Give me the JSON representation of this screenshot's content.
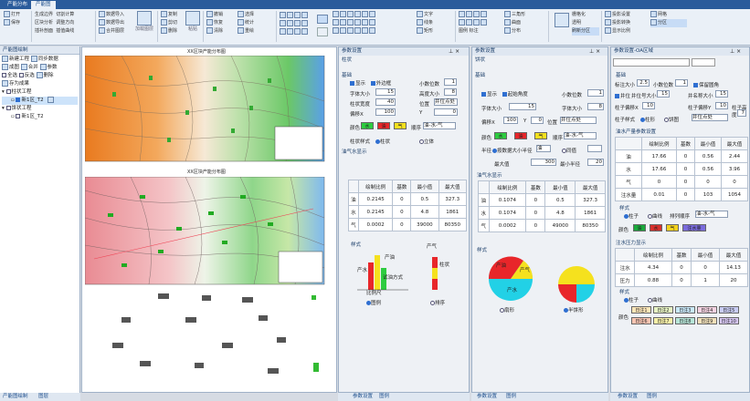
{
  "tabs": [
    "产能分布",
    "产能图"
  ],
  "ribbon": {
    "g1": [
      "打开",
      "保存"
    ],
    "g2": [
      "生成边界",
      "切割计算",
      "区块分析",
      "调整方向",
      "插补剖面",
      "插值曲线"
    ],
    "g3": [
      "数据导入",
      "数据导出",
      "合并图层"
    ],
    "g3b": "加载图层",
    "g4": [
      "复制",
      "剪切",
      "删除"
    ],
    "g4b": "粘贴",
    "g5": [
      "撤销",
      "恢复",
      "清除"
    ],
    "g6": [
      "选择",
      "统计",
      "重绘"
    ],
    "g7": [
      "全显",
      "缩放",
      "平移"
    ],
    "g8": [
      "文字",
      "线条",
      "矩形"
    ],
    "g9": [
      "图例",
      "标注"
    ],
    "g10": [
      "三角形",
      "曲面",
      "分布"
    ],
    "g11": [
      "栅格化",
      "透明",
      "刷新分区"
    ],
    "g12": [
      "投影设置",
      "投影转换",
      "显示比例"
    ],
    "g13": [
      "网格",
      "分区"
    ]
  },
  "left": {
    "title": "产能图绘制",
    "toolbar": [
      "新建工程",
      "同步数据",
      "成图",
      "合并",
      "参数"
    ],
    "toolbar2": [
      "全选",
      "反选",
      "删除"
    ],
    "nodes": [
      "存为成果",
      "柱状工程",
      "新1区_T2",
      "饼状工程",
      "新1区_T2"
    ],
    "bottom_tabs": [
      "产能图绘制",
      "图层"
    ]
  },
  "canvas": {
    "map1_title": "XX区块产能分布图",
    "map2_title": "XX区块产能分布图"
  },
  "p1": {
    "title": "参数设置",
    "sub": "柱状",
    "sec_basic": "基础",
    "chk_show": "显示",
    "chk_frame": "外边框",
    "decimal_label": "小数位数",
    "decimal_value": "1",
    "font_size_label": "字体大小",
    "font_size": "15",
    "height_label": "高度大小",
    "height_value": "8",
    "bar_width_label": "柱状宽度",
    "bar_width": "40",
    "position_label": "位置",
    "position_value": "井位点处",
    "offset_x_label": "偏移X",
    "offset_x": "100",
    "offset_y_label": "Y",
    "offset_y": "0",
    "colors_label": "颜色",
    "colors": [
      "水",
      "油",
      "气"
    ],
    "c_water": "#2ecc40",
    "c_oil": "#e8262a",
    "c_gas": "#f5e11e",
    "order_label": "顺序",
    "order_value": "油-水-气",
    "style_label": "柱状样式",
    "style_opts": [
      "柱状",
      "立体"
    ],
    "table_title": "油气水显示",
    "table_headers": [
      "",
      "绘制比例",
      "基数",
      "最小值",
      "最大值"
    ],
    "rows": [
      [
        "油",
        "0.2145",
        "0",
        "0.5",
        "327.3"
      ],
      [
        "水",
        "0.2145",
        "0",
        "4.8",
        "1861"
      ],
      [
        "气",
        "0.0002",
        "0",
        "39000",
        "80350"
      ]
    ],
    "style_sec": "样式",
    "leg_labels": [
      "产油",
      "产水",
      "产气",
      "比例尺",
      "试油方式",
      "柱状"
    ],
    "leg_radio": [
      "图例",
      "排序"
    ],
    "bottom_tabs": [
      "参数设置",
      "图例"
    ]
  },
  "p2": {
    "title": "参数设置",
    "sub": "饼状",
    "sec_basic": "基础",
    "chk_show": "显示",
    "chk_frame": "起始角度",
    "decimal_label": "小数位数",
    "decimal_value": "1",
    "font_size_label": "字体大小",
    "font_size": "15",
    "font_height_label": "字体大小",
    "font_height": "8",
    "offset_x_label": "偏移X",
    "offset_x": "100",
    "offset_y_label": "Y",
    "offset_y": "0",
    "pos_label": "位置",
    "pos_value": "井位点处",
    "colors_label": "颜色",
    "colors": [
      "水",
      "油",
      "气"
    ],
    "c_water": "#2ecc40",
    "c_oil": "#e8262a",
    "c_gas": "#f5e11e",
    "order_label": "顺序",
    "order_value": "油-水-气",
    "radius_label": "半径",
    "radius_opt": "按数据大小半径",
    "radius_sel": "油",
    "same_label": "同值",
    "min_radius_label": "最大值",
    "min_radius": "300",
    "max_radius_label": "最小半径",
    "max_radius": "20",
    "table_title": "油气水显示",
    "table_headers": [
      "",
      "绘制比例",
      "基数",
      "最小值",
      "最大值"
    ],
    "rows": [
      [
        "油",
        "0.1074",
        "0",
        "0.5",
        "327.3"
      ],
      [
        "水",
        "0.1074",
        "0",
        "4.8",
        "1861"
      ],
      [
        "气",
        "0.0002",
        "0",
        "49000",
        "80350"
      ]
    ],
    "style_sec": "样式",
    "pie_labels": [
      "产油",
      "产水",
      "产气"
    ],
    "pie_radio": [
      "扇形",
      "半饼形"
    ],
    "bottom_tabs": [
      "参数设置",
      "图例"
    ]
  },
  "p3": {
    "title": "参数设置-OA区域",
    "sec_basic": "基础",
    "label_size_label": "标注大小",
    "label_size": "2.5",
    "decimal_label": "小数位数",
    "decimal_value": "1",
    "chk_round": "保留圆角",
    "chk_well": "井位",
    "well_size_label": "井位号大小",
    "well_size": "15",
    "name_size_label": "井名称大小",
    "name_size": "15",
    "offset_x_label": "柱子偏移X",
    "offset_x": "10",
    "offset_y_label": "柱子偏移Y",
    "offset_y": "10",
    "font_label": "柱子高度",
    "font_value": "7",
    "mode_label": "柱子样式",
    "mode_opts": [
      "柱形",
      "饼图"
    ],
    "mode_sel": "井位点处",
    "table1_title": "油水产量参数设置",
    "t1_headers": [
      "",
      "绘制比例",
      "基数",
      "最小值",
      "最大值"
    ],
    "t1_rows": [
      [
        "油",
        "17.66",
        "0",
        "0.56",
        "2.44"
      ],
      [
        "水",
        "17.66",
        "0",
        "0.56",
        "3.96"
      ],
      [
        "气",
        "0",
        "0",
        "0",
        "0"
      ],
      [
        "注水量",
        "0.01",
        "0",
        "103",
        "1054"
      ]
    ],
    "style_label": "样式",
    "style_opts": [
      "柱子",
      "曲线"
    ],
    "order_label": "排列顺序",
    "order_value": "油-水-气",
    "color_label": "颜色",
    "colors": [
      "油",
      "水",
      "气",
      "注水量"
    ],
    "c1": "#1aaa3c",
    "c2": "#d7302d",
    "c3": "#f4d21c",
    "c4": "#7a6bdc",
    "table2_title": "注水压力显示",
    "t2_headers": [
      "",
      "绘制比例",
      "基数",
      "最小值",
      "最大值"
    ],
    "t2_rows": [
      [
        "注水",
        "4.34",
        "0",
        "0",
        "14.13"
      ],
      [
        "压力",
        "0.88",
        "0",
        "1",
        "20"
      ]
    ],
    "style2_label": "样式",
    "style2_opts": [
      "柱子",
      "曲线"
    ],
    "grid_label": "颜色",
    "grid_row1": [
      "日注1",
      "日注2",
      "日注3",
      "日注4",
      "日注5"
    ],
    "grid_row2": [
      "日注6",
      "日注7",
      "日注8",
      "日注9",
      "日注10"
    ],
    "bottom_tabs": [
      "参数设置",
      "图例"
    ]
  }
}
